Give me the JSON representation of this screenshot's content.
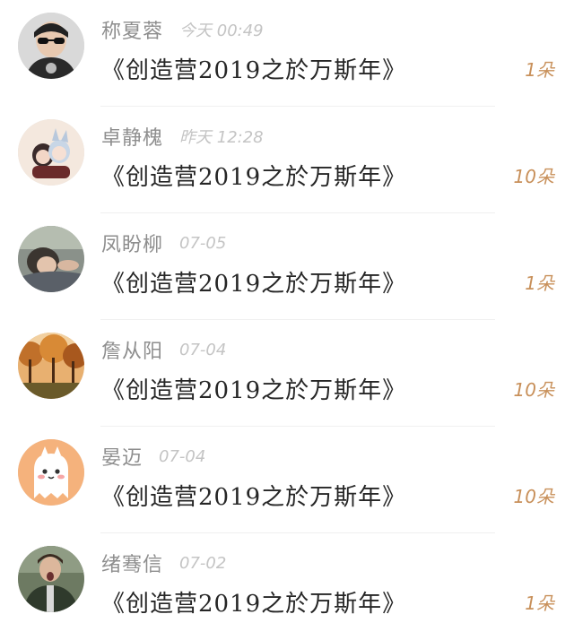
{
  "records": [
    {
      "name": "称夏蓉",
      "time": "今天 00:49",
      "gift": "《创造营2019之於万斯年》",
      "count": "1朵",
      "avatar_icon": "person-sunglasses-avatar",
      "avatar_color": "#5a5a5a"
    },
    {
      "name": "卓静槐",
      "time": "昨天 12:28",
      "gift": "《创造营2019之於万斯年》",
      "count": "10朵",
      "avatar_icon": "anime-characters-avatar",
      "avatar_color": "#f2e4d8"
    },
    {
      "name": "凤盼柳",
      "time": "07-05",
      "gift": "《创造营2019之於万斯年》",
      "count": "1朵",
      "avatar_icon": "person-lying-avatar",
      "avatar_color": "#7a7f7a"
    },
    {
      "name": "詹从阳",
      "time": "07-04",
      "gift": "《创造营2019之於万斯年》",
      "count": "10朵",
      "avatar_icon": "autumn-forest-avatar",
      "avatar_color": "#a0652e"
    },
    {
      "name": "晏迈",
      "time": "07-04",
      "gift": "《创造营2019之於万斯年》",
      "count": "10朵",
      "avatar_icon": "cartoon-ghost-avatar",
      "avatar_color": "#f3b27d"
    },
    {
      "name": "绪骞信",
      "time": "07-02",
      "gift": "《创造营2019之於万斯年》",
      "count": "1朵",
      "avatar_icon": "person-singing-avatar",
      "avatar_color": "#3d4a3a"
    }
  ]
}
